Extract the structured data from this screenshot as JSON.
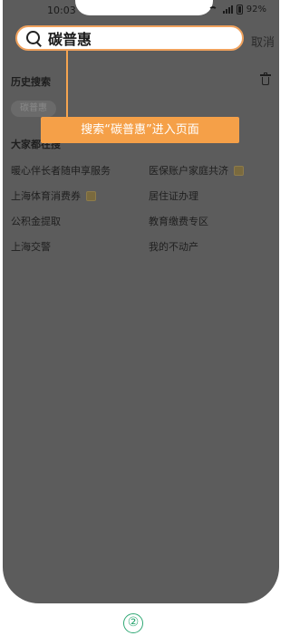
{
  "status_bar": {
    "time": "10:03",
    "battery": "92%"
  },
  "search": {
    "value": "碳普惠",
    "cancel_label": "取消"
  },
  "history": {
    "title": "历史搜索",
    "items": [
      "碳普惠"
    ]
  },
  "hot": {
    "title": "大家都在搜",
    "items": [
      {
        "label": "暖心伴长者随申享服务",
        "badge": false
      },
      {
        "label": "医保账户家庭共济",
        "badge": true
      },
      {
        "label": "上海体育消费券",
        "badge": true
      },
      {
        "label": "居住证办理",
        "badge": false
      },
      {
        "label": "公积金提取",
        "badge": false
      },
      {
        "label": "教育缴费专区",
        "badge": false
      },
      {
        "label": "上海交警",
        "badge": false
      },
      {
        "label": "我的不动产",
        "badge": false
      }
    ]
  },
  "annotation": {
    "callout": "搜索“碳普惠”进入页面",
    "step": "②"
  },
  "colors": {
    "overlay": "#5c5c5c",
    "accent": "#f5a048",
    "step": "#2fa874"
  }
}
